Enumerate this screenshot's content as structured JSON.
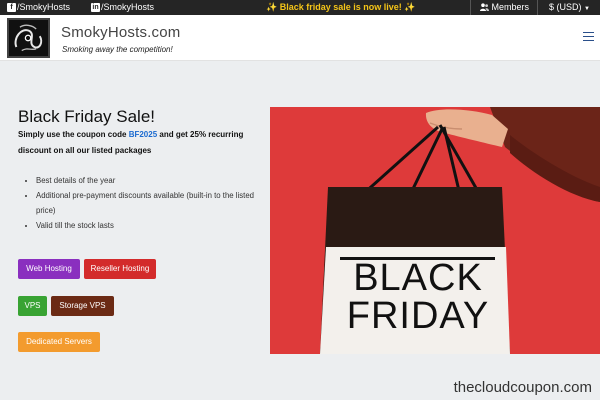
{
  "topbar": {
    "facebook_label": "/SmokyHosts",
    "linkedin_label": "/SmokyHosts",
    "promo_text": "Black friday sale is now live!",
    "promo_spark": "✨",
    "members_label": "Members",
    "currency_label": "$ (USD)"
  },
  "header": {
    "brand_name": "SmokyHosts.com",
    "tagline": "Smoking away the competition!"
  },
  "hero": {
    "title": "Black Friday Sale!",
    "desc_before": "Simply use the coupon code ",
    "coupon_code": "BF2025",
    "desc_after": " and get 25% recurring discount on all our listed packages",
    "features": [
      "Best details of the year",
      "Additional pre-payment discounts available (built-in to the listed price)",
      "Valid till the stock lasts"
    ]
  },
  "buttons": {
    "web_hosting": "Web Hosting",
    "reseller_hosting": "Reseller Hosting",
    "vps": "VPS",
    "storage_vps": "Storage VPS",
    "dedicated_servers": "Dedicated Servers"
  },
  "photo": {
    "bag_line1": "BLACK",
    "bag_line2": "FRIDAY"
  },
  "watermark": "thecloudcoupon.com",
  "colors": {
    "topbar_bg": "#252525",
    "promo_yellow": "#f5c518",
    "coupon_blue": "#1a6ad0",
    "web_hosting": "#8a2fbf",
    "reseller_hosting": "#d32b2b",
    "vps": "#38a333",
    "storage_vps": "#6b2a14",
    "dedicated_servers": "#f39b2e",
    "photo_red": "#de3a3a"
  },
  "icons": {
    "facebook": "facebook-icon",
    "linkedin": "linkedin-icon",
    "members": "users-icon",
    "currency_caret": "caret-down-icon",
    "menu": "hamburger-menu-icon"
  }
}
